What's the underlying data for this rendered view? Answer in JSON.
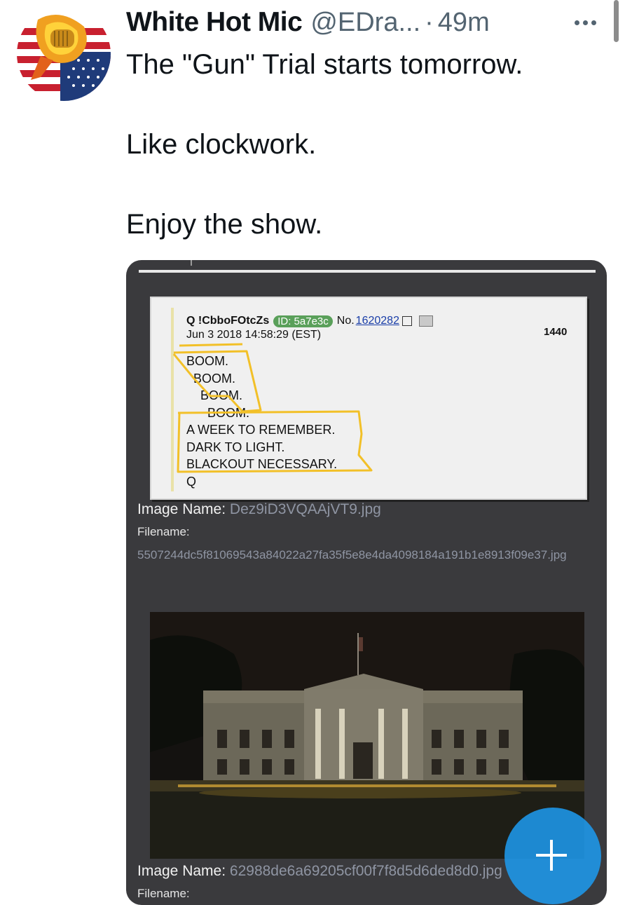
{
  "author": {
    "display_name": "White Hot Mic",
    "handle": "@EDra...",
    "separator": "·",
    "time": "49m"
  },
  "tweet": {
    "lines": [
      "The \"Gun\" Trial starts tomorrow.",
      "Like clockwork.",
      "Enjoy the show."
    ]
  },
  "qpost": {
    "name": "Q !CbboFOtcZs",
    "id": "ID: 5a7e3c",
    "no_label": "No.",
    "no_value": "1620282",
    "date": "Jun 3 2018 14:58:29 (EST)",
    "count": "1440",
    "body": [
      "BOOM.",
      "  BOOM.",
      "    BOOM.",
      "      BOOM.",
      "A WEEK TO REMEMBER.",
      "DARK TO LIGHT.",
      "BLACKOUT NECESSARY.",
      "Q"
    ]
  },
  "image1": {
    "name_label": "Image Name:",
    "name_value": "Dez9iD3VQAAjVT9.jpg",
    "filename_label": "Filename:",
    "filename_value": "5507244dc5f81069543a84022a27fa35f5e8e4da4098184a191b1e8913f09e37.jpg"
  },
  "image2": {
    "name_label": "Image Name:",
    "name_value": "62988de6a69205cf00f7f8d5d6ded8d0.jpg",
    "filename_label": "Filename:"
  },
  "colors": {
    "accent": "#1d9bf0",
    "text": "#0f1419",
    "secondary": "#536471",
    "card_bg": "#3a3a3d",
    "highlight": "#f2c028"
  },
  "icons": {
    "more": "more-horizontal-icon",
    "compose": "plus-icon",
    "external": "external-link-icon",
    "folder": "folder-icon"
  }
}
